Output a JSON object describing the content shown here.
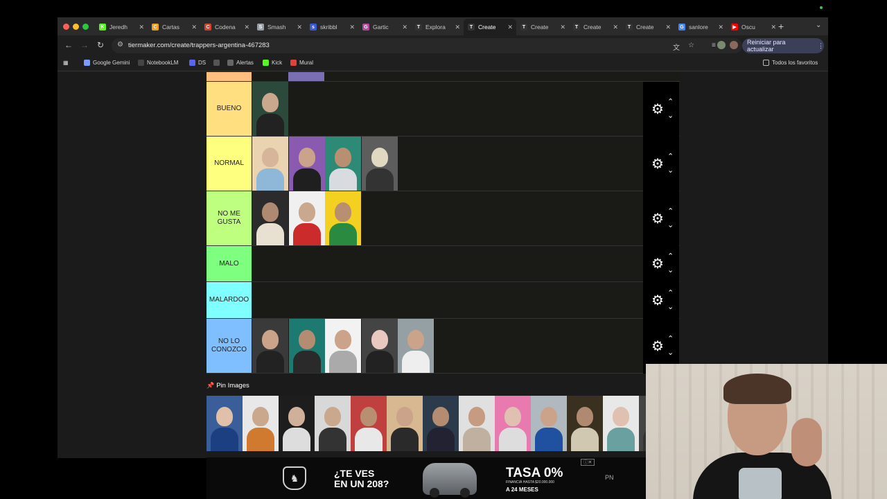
{
  "browser": {
    "tabs": [
      {
        "title": "Jeredh",
        "icon": "kick-icon",
        "color": "#53fc18",
        "letter": "K"
      },
      {
        "title": "Cartas",
        "icon": "cards-icon",
        "color": "#f0a020",
        "letter": "C"
      },
      {
        "title": "Codena",
        "icon": "codenames-icon",
        "color": "#d0452f",
        "letter": "C"
      },
      {
        "title": "Smash",
        "icon": "smash-icon",
        "color": "#9aa0a6",
        "letter": "S"
      },
      {
        "title": "skribbl",
        "icon": "skribbl-icon",
        "color": "#3b5bd6",
        "letter": "s"
      },
      {
        "title": "Gartic",
        "icon": "gartic-icon",
        "color": "#b04aa0",
        "letter": "G"
      },
      {
        "title": "Explora",
        "icon": "tiermaker-icon",
        "color": "#333",
        "letter": "T"
      },
      {
        "title": "Create",
        "icon": "tiermaker-icon",
        "color": "#333",
        "letter": "T",
        "active": true
      },
      {
        "title": "Create",
        "icon": "tiermaker-icon",
        "color": "#333",
        "letter": "T"
      },
      {
        "title": "Create",
        "icon": "tiermaker-icon",
        "color": "#333",
        "letter": "T"
      },
      {
        "title": "Create",
        "icon": "tiermaker-icon",
        "color": "#333",
        "letter": "T"
      },
      {
        "title": "sanlore",
        "icon": "google-icon",
        "color": "#4285f4",
        "letter": "G"
      },
      {
        "title": "Oscu",
        "icon": "youtube-icon",
        "color": "#ff0000",
        "letter": "▶"
      }
    ],
    "url": "tiermaker.com/create/trappers-argentina-467283",
    "update_button": "Reiniciar para actualizar",
    "bookmarks": [
      {
        "label": "Google Gemini",
        "icon": "gemini-icon",
        "color": "#7b9cff"
      },
      {
        "label": "NotebookLM",
        "icon": "notebooklm-icon",
        "color": "#444"
      },
      {
        "label": "DS",
        "icon": "discord-icon",
        "color": "#5865f2"
      },
      {
        "label": "",
        "icon": "globe-icon",
        "color": "#555"
      },
      {
        "label": "Alertas",
        "icon": "alerts-icon",
        "color": "#666"
      },
      {
        "label": "Kick",
        "icon": "kick-icon",
        "color": "#53fc18"
      },
      {
        "label": "Mural",
        "icon": "mural-icon",
        "color": "#e0413b"
      }
    ],
    "all_bookmarks": "Todos los favoritos"
  },
  "tiers": [
    {
      "label": "BUENO",
      "color": "#ffdf7f",
      "thumbs": 1
    },
    {
      "label": "NORMAL",
      "color": "#ffff7f",
      "thumbs": 4
    },
    {
      "label": "NO ME GUSTA",
      "color": "#bfff7f",
      "thumbs": 3
    },
    {
      "label": "MALO",
      "color": "#7fff7f",
      "thumbs": 0
    },
    {
      "label": "MALARDOO",
      "color": "#7fffff",
      "thumbs": 0
    },
    {
      "label": "NO LO CONOZCO",
      "color": "#7fbfff",
      "thumbs": 5
    }
  ],
  "pin_images_label": "Pin Images",
  "ad": {
    "headline_line1": "¿TE VES",
    "headline_line2": "EN UN 208?",
    "rate": "TASA 0%",
    "subtext": "FINANCIÁ HASTA $20.000.000",
    "months": "A 24 MESES",
    "badge": "PN"
  }
}
